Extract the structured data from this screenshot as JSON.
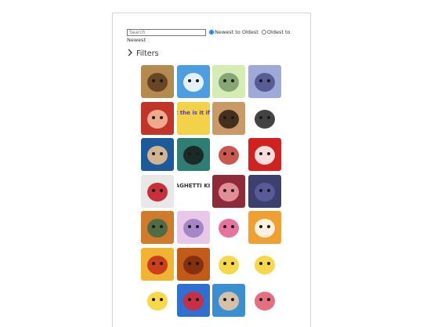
{
  "search": {
    "placeholder": "Search",
    "value": ""
  },
  "sort": {
    "options": [
      {
        "label": "Newest to Oldest",
        "checked": true
      },
      {
        "label": "Oldest to Newest",
        "checked": false
      }
    ]
  },
  "filters": {
    "label": "Filters",
    "icon": "chevron-right-icon"
  },
  "tiles": [
    {
      "name": "art-tile-1",
      "bg": "#b58a4e",
      "fg": "#5a3a1c"
    },
    {
      "name": "art-tile-2",
      "bg": "#4d9ee0",
      "fg": "#ffffff"
    },
    {
      "name": "art-tile-3",
      "bg": "#d6ecb5",
      "fg": "#7a9a6a"
    },
    {
      "name": "art-tile-4",
      "bg": "#9fa9d8",
      "fg": "#4a4f8a"
    },
    {
      "name": "art-tile-5",
      "bg": "#c0342a",
      "fg": "#f7c0a0"
    },
    {
      "name": "art-tile-6",
      "bg": "#f3d24a",
      "fg": "#5b3ba8",
      "text": "What the is it if Butt"
    },
    {
      "name": "art-tile-7",
      "bg": "#c89a68",
      "fg": "#2b1d12"
    },
    {
      "name": "art-tile-8",
      "bg": "#ffffff",
      "fg": "#222222"
    },
    {
      "name": "art-tile-9",
      "bg": "#1b5b9c",
      "fg": "#f2c48e"
    },
    {
      "name": "art-tile-10",
      "bg": "#2f7e74",
      "fg": "#1a1a1a"
    },
    {
      "name": "art-tile-11",
      "bg": "#ffffff",
      "fg": "#c0392b"
    },
    {
      "name": "art-tile-12",
      "bg": "#d1221f",
      "fg": "#ffffff"
    },
    {
      "name": "art-tile-13",
      "bg": "#e8e8e8",
      "fg": "#c0101a"
    },
    {
      "name": "art-tile-14",
      "bg": "#ffffff",
      "fg": "#333333",
      "text": "SPAGHETTI KING"
    },
    {
      "name": "art-tile-15",
      "bg": "#8f2a3a",
      "fg": "#f0a0a8"
    },
    {
      "name": "art-tile-16",
      "bg": "#3d3f6e",
      "fg": "#5d60a0"
    },
    {
      "name": "art-tile-17",
      "bg": "#d07a2a",
      "fg": "#3a6a4a"
    },
    {
      "name": "art-tile-18",
      "bg": "#e7c8e8",
      "fg": "#9a7ac0"
    },
    {
      "name": "art-tile-19",
      "bg": "#ffffff",
      "fg": "#e25a8a"
    },
    {
      "name": "art-tile-20",
      "bg": "#f0a030",
      "fg": "#ffffff"
    },
    {
      "name": "art-tile-21",
      "bg": "#f0b432",
      "fg": "#c42a1a"
    },
    {
      "name": "art-tile-22",
      "bg": "#c25a18",
      "fg": "#7a2a10"
    },
    {
      "name": "art-tile-23",
      "bg": "#ffffff",
      "fg": "#f5d12a"
    },
    {
      "name": "art-tile-24",
      "bg": "#ffffff",
      "fg": "#f5d12a"
    },
    {
      "name": "art-tile-25",
      "bg": "#ffffff",
      "fg": "#f5d12a"
    },
    {
      "name": "art-tile-26",
      "bg": "#2f6fd1",
      "fg": "#e0262a"
    },
    {
      "name": "art-tile-27",
      "bg": "#3a8fd1",
      "fg": "#f4c9a0"
    },
    {
      "name": "art-tile-28",
      "bg": "#ffffff",
      "fg": "#e0566a"
    }
  ]
}
